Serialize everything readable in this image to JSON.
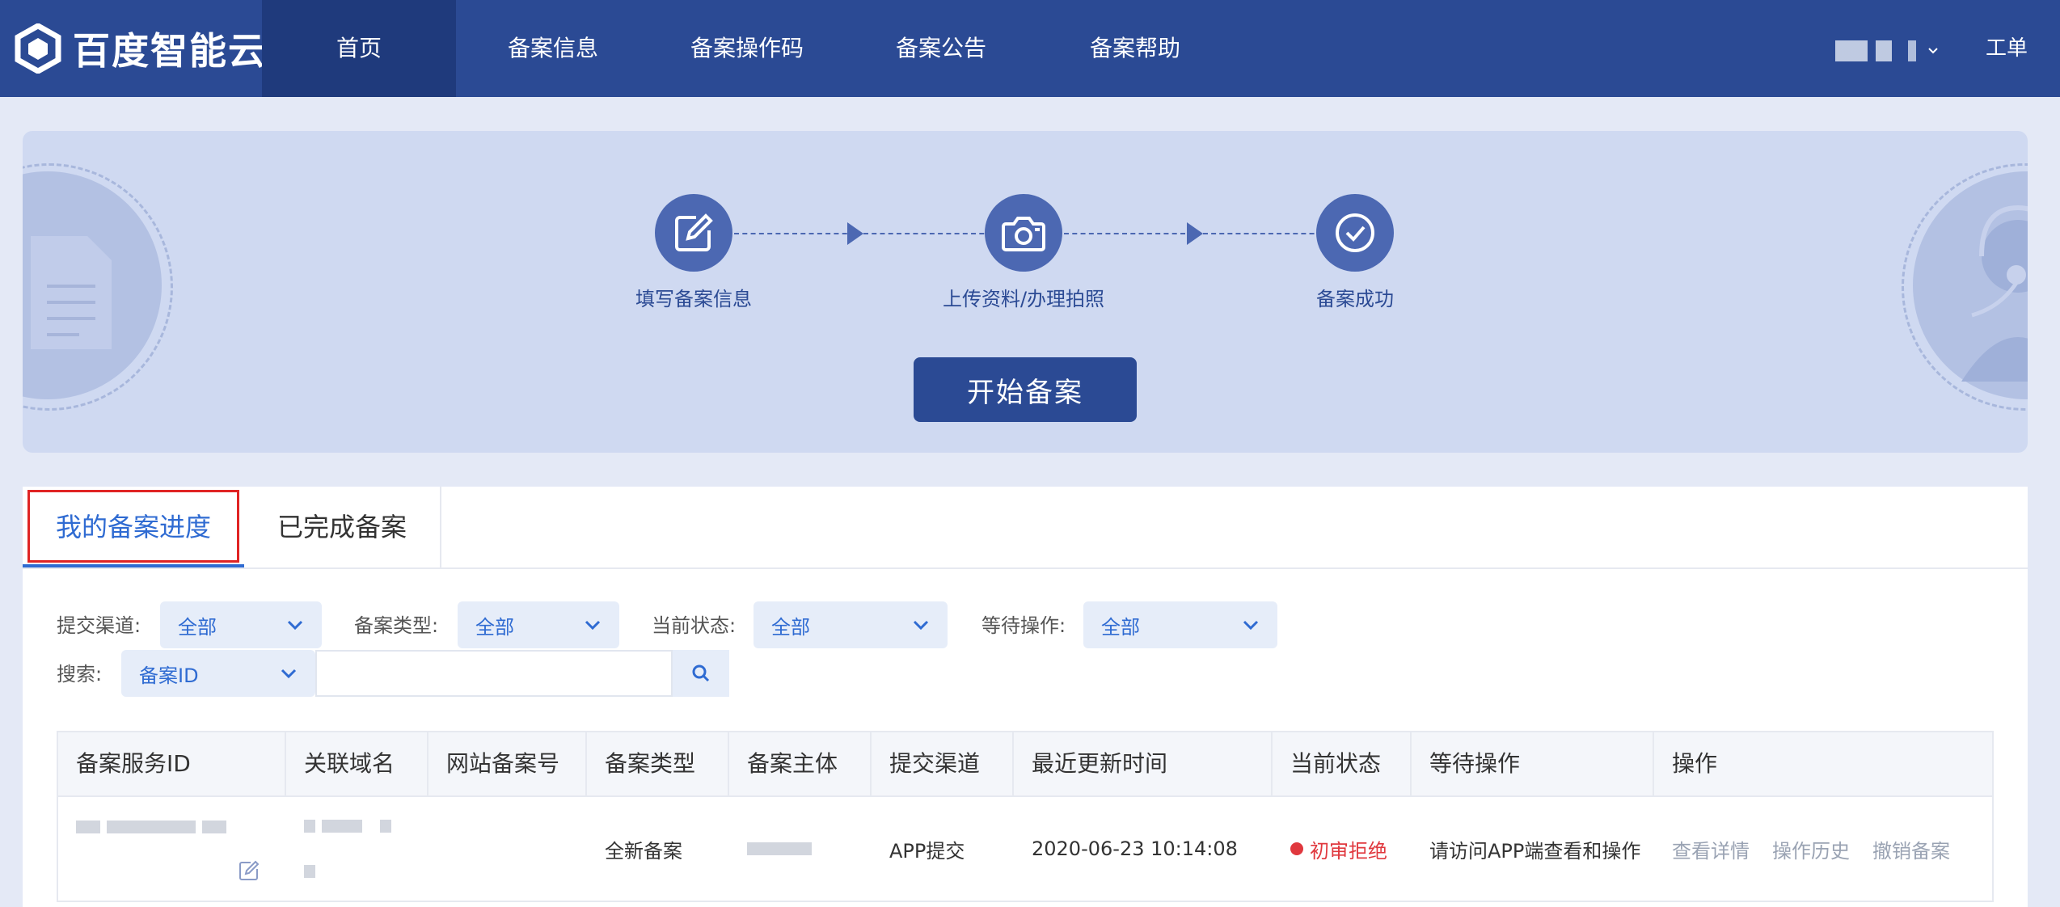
{
  "nav": {
    "logo_text": "百度智能云",
    "items": [
      {
        "label": "首页",
        "active": true
      },
      {
        "label": "备案信息"
      },
      {
        "label": "备案操作码"
      },
      {
        "label": "备案公告"
      },
      {
        "label": "备案帮助"
      }
    ],
    "ticket_label": "工单"
  },
  "banner": {
    "steps": [
      {
        "label": "填写备案信息",
        "icon": "edit-icon"
      },
      {
        "label": "上传资料/办理拍照",
        "icon": "camera-icon"
      },
      {
        "label": "备案成功",
        "icon": "check-icon"
      }
    ],
    "start_label": "开始备案"
  },
  "tabs": [
    {
      "label": "我的备案进度",
      "active": true
    },
    {
      "label": "已完成备案"
    }
  ],
  "filters": {
    "channel": {
      "label": "提交渠道:",
      "value": "全部"
    },
    "type": {
      "label": "备案类型:",
      "value": "全部"
    },
    "status": {
      "label": "当前状态:",
      "value": "全部"
    },
    "waiting": {
      "label": "等待操作:",
      "value": "全部"
    },
    "search": {
      "label": "搜索:",
      "field": "备案ID",
      "value": ""
    }
  },
  "table": {
    "headers": [
      "备案服务ID",
      "关联域名",
      "网站备案号",
      "备案类型",
      "备案主体",
      "提交渠道",
      "最近更新时间",
      "当前状态",
      "等待操作",
      "操作"
    ],
    "rows": [
      {
        "type": "全新备案",
        "channel": "APP提交",
        "updated": "2020-06-23 10:14:08",
        "status": "初审拒绝",
        "waiting": "请访问APP端查看和操作",
        "ops": [
          "查看详情",
          "操作历史",
          "撤销备案"
        ]
      }
    ]
  },
  "colors": {
    "nav_bg": "#2b4a94",
    "accent": "#2f6bd2",
    "danger": "#e0383e"
  }
}
